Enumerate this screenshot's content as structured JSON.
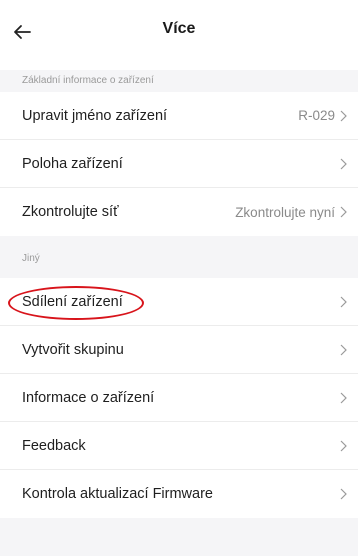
{
  "header": {
    "title": "Více"
  },
  "section1": {
    "label": "Základní informace o zařízení",
    "items": [
      {
        "label": "Upravit jméno zařízení",
        "value": "R-029"
      },
      {
        "label": "Poloha zařízení",
        "value": ""
      },
      {
        "label": "Zkontrolujte síť",
        "value": "Zkontrolujte nyní"
      }
    ]
  },
  "section2": {
    "label": "Jiný",
    "items": [
      {
        "label": "Sdílení zařízení",
        "highlighted": true
      },
      {
        "label": "Vytvořit skupinu"
      },
      {
        "label": "Informace o zařízení"
      },
      {
        "label": "Feedback"
      },
      {
        "label": "Kontrola aktualizací Firmware"
      }
    ]
  },
  "colors": {
    "highlight_annotation": "#d8141b",
    "background": "#f5f5f7",
    "card": "#ffffff"
  },
  "icons": {
    "back": "arrow-left-icon",
    "row_arrow": "chevron-right-icon"
  }
}
